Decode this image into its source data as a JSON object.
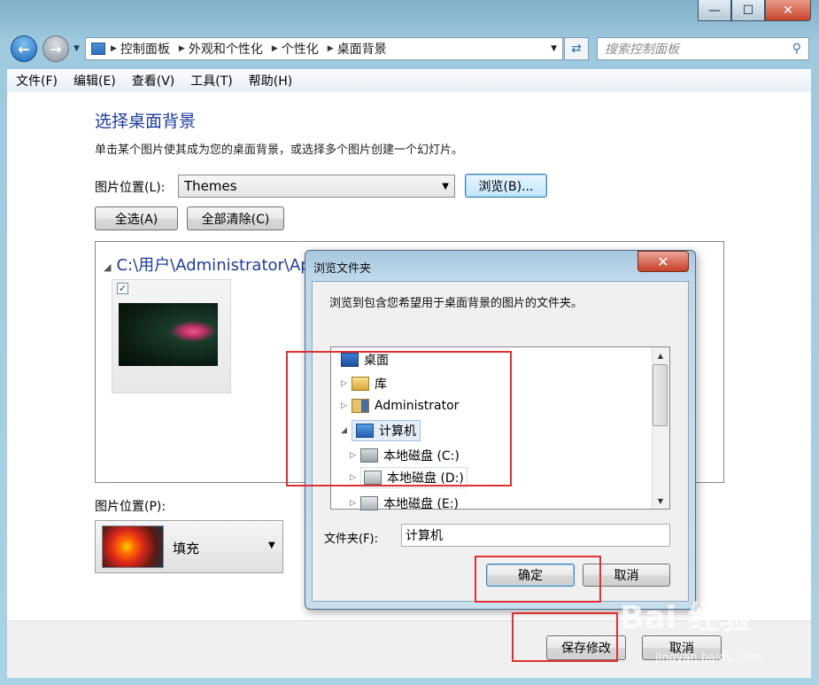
{
  "window": {
    "minimize_glyph": "—",
    "maximize_glyph": "☐",
    "close_glyph": "✕"
  },
  "address": {
    "crumbs": [
      "控制面板",
      "外观和个性化",
      "个性化",
      "桌面背景"
    ],
    "search_placeholder": "搜索控制面板"
  },
  "menu": [
    "文件(F)",
    "编辑(E)",
    "查看(V)",
    "工具(T)",
    "帮助(H)"
  ],
  "page": {
    "title": "选择桌面背景",
    "description": "单击某个图片使其成为您的桌面背景，或选择多个图片创建一个幻灯片。",
    "location_label": "图片位置(L):",
    "location_value": "Themes",
    "browse_label": "浏览(B)...",
    "select_all_label": "全选(A)",
    "clear_all_label": "全部清除(C)",
    "gallery_path": "C:\\用户\\Administrator\\Ap",
    "position_label": "图片位置(P):",
    "position_value": "填充",
    "save_label": "保存修改",
    "cancel_label": "取消"
  },
  "dialog": {
    "title": "浏览文件夹",
    "description": "浏览到包含您希望用于桌面背景的图片的文件夹。",
    "tree": [
      {
        "label": "桌面",
        "icon": "desktop-icon"
      },
      {
        "label": "库",
        "icon": "library-icon"
      },
      {
        "label": "Administrator",
        "icon": "user-folder-icon"
      },
      {
        "label": "计算机",
        "icon": "computer-icon"
      },
      {
        "label": "本地磁盘 (C:)",
        "icon": "system-drive-icon"
      },
      {
        "label": "本地磁盘 (D:)",
        "icon": "drive-icon"
      },
      {
        "label": "本地磁盘 (E:)",
        "icon": "drive-icon"
      }
    ],
    "folder_label": "文件夹(F):",
    "folder_value": "计算机",
    "ok_label": "确定",
    "cancel_label": "取消"
  },
  "watermark": {
    "brand": "Bai 经验",
    "url": "jingyan.baidu.com"
  },
  "colors": {
    "accent_title": "#1e3c9c",
    "highlight_box": "#e03030"
  }
}
